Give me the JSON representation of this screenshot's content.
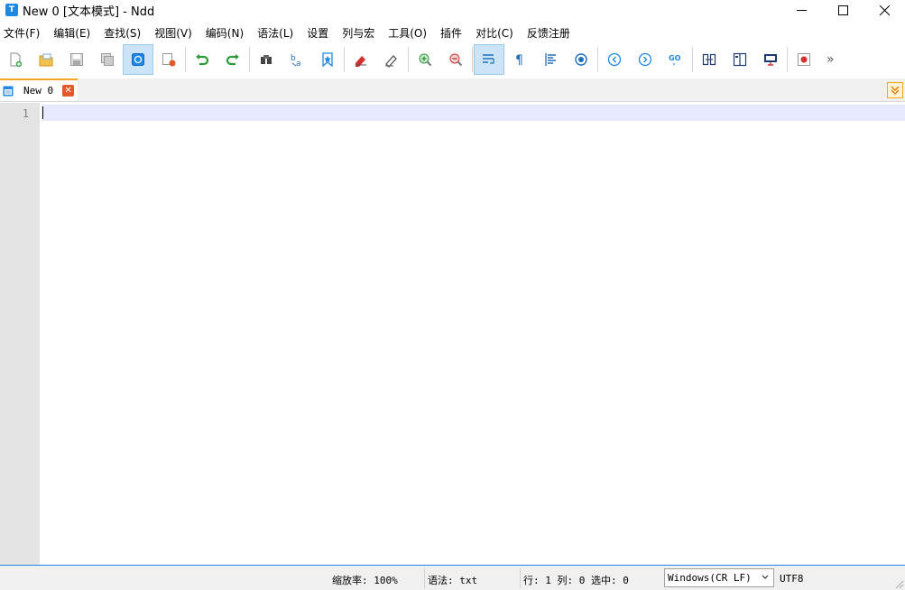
{
  "window": {
    "title": "New 0 [文本模式] - Ndd",
    "app_icon_glyph": "T",
    "accent": "#1e88e5"
  },
  "menu": [
    "文件(F)",
    "编辑(E)",
    "查找(S)",
    "视图(V)",
    "编码(N)",
    "语法(L)",
    "设置",
    "列与宏",
    "工具(O)",
    "插件",
    "对比(C)",
    "反馈注册"
  ],
  "toolbar": {
    "buttons": [
      {
        "name": "new-file-icon"
      },
      {
        "name": "open-file-icon"
      },
      {
        "name": "save-icon"
      },
      {
        "name": "save-all-icon"
      },
      {
        "name": "auto-save-icon"
      },
      {
        "name": "close-file-icon"
      },
      {
        "name": "undo-icon"
      },
      {
        "name": "redo-icon"
      },
      {
        "name": "find-icon"
      },
      {
        "name": "replace-icon"
      },
      {
        "name": "bookmark-icon"
      },
      {
        "name": "mark-icon"
      },
      {
        "name": "clear-mark-icon"
      },
      {
        "name": "zoom-in-icon"
      },
      {
        "name": "zoom-out-icon"
      },
      {
        "name": "word-wrap-icon"
      },
      {
        "name": "show-symbols-icon"
      },
      {
        "name": "indent-guide-icon"
      },
      {
        "name": "highlight-icon"
      },
      {
        "name": "prev-position-icon"
      },
      {
        "name": "next-position-icon"
      },
      {
        "name": "goto-line-icon"
      },
      {
        "name": "file-compare-icon"
      },
      {
        "name": "dir-compare-icon"
      },
      {
        "name": "binary-compare-icon"
      },
      {
        "name": "record-macro-icon"
      }
    ],
    "more_glyph": "»"
  },
  "tabs": [
    {
      "label": "New 0",
      "close_glyph": "✕"
    }
  ],
  "editor": {
    "line_numbers": [
      "1"
    ]
  },
  "status": {
    "zoom": "缩放率: 100%",
    "syntax": "语法: txt",
    "position": "行: 1 列: 0 选中: 0",
    "eol": "Windows(CR LF)",
    "encoding": "UTF8"
  }
}
